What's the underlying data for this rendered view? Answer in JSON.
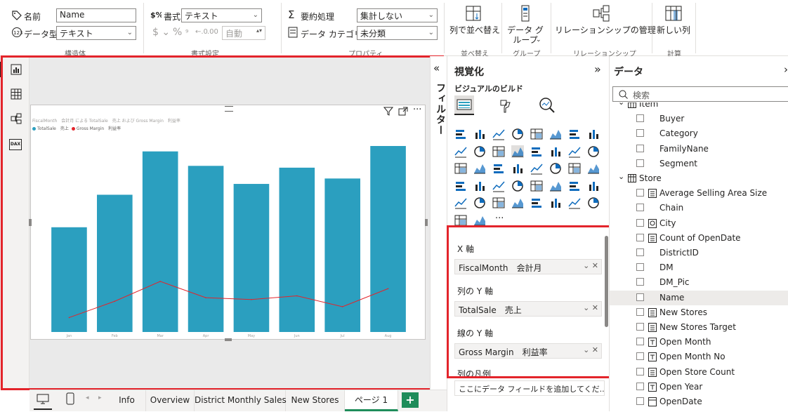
{
  "ribbon": {
    "structure": {
      "name_label": "名前",
      "name_value": "Name",
      "datatype_label": "データ型",
      "datatype_value": "テキスト",
      "group": "構造体"
    },
    "format": {
      "format_label": "書式",
      "format_value": "テキスト",
      "auto_value": "自動",
      "group": "書式設定"
    },
    "properties": {
      "summarize_label": "要約処理",
      "summarize_value": "集計しない",
      "category_label": "データ カテゴリ",
      "category_value": "未分類",
      "group": "プロパティ"
    },
    "sort": {
      "label": "列で並べ替え",
      "group": "並べ替え"
    },
    "groups": {
      "label": "データ グループ",
      "group": "グループ"
    },
    "relationships": {
      "label": "リレーションシップの管理",
      "group": "リレーションシップ"
    },
    "calc": {
      "label": "新しい列",
      "group": "計算"
    }
  },
  "rail": {
    "icons": [
      "report-view-icon",
      "table-view-icon",
      "model-view-icon",
      "dax-query-icon"
    ],
    "dax": "DAX"
  },
  "visual_header": {
    "title": "FiscalMonth　会計月 による TotalSale　売上 および Gross Margin　利益率",
    "legend_items": [
      {
        "label": "TotalSale　売上",
        "color": "#2b9fbf"
      },
      {
        "label": "Gross Margin　利益率",
        "color": "#e3242b"
      }
    ]
  },
  "chart_data": {
    "type": "bar",
    "categories": [
      "Jan",
      "Feb",
      "Mar",
      "Apr",
      "May",
      "Jun",
      "Jul",
      "Aug"
    ],
    "series": [
      {
        "name": "TotalSale　売上",
        "type": "bar",
        "values": [
          58,
          76,
          100,
          92,
          82,
          91,
          85,
          103
        ]
      },
      {
        "name": "Gross Margin　利益率",
        "type": "line",
        "values": [
          8,
          17,
          28,
          19,
          18,
          20,
          14,
          24
        ]
      }
    ],
    "ylim": [
      0,
      110
    ],
    "bar_color": "#2b9fbf",
    "line_color": "#e3242b"
  },
  "filter_pane": {
    "label": "フィルター"
  },
  "viz_pane": {
    "title": "視覚化",
    "build_label": "ビジュアルのビルド",
    "collapse_glyph": "»",
    "expand_glyph": "«",
    "wells": [
      {
        "title": "X 軸",
        "field": "FiscalMonth　会計月"
      },
      {
        "title": "列の Y 軸",
        "field": "TotalSale　売上"
      },
      {
        "title": "線の Y 軸",
        "field": "Gross Margin　利益率"
      },
      {
        "title": "列の凡例",
        "field": ""
      }
    ],
    "add_field_placeholder": "ここにデータ フィールドを追加してくだ...",
    "more_glyph": "···"
  },
  "data_pane": {
    "title": "データ",
    "search_placeholder": "検索",
    "top_table": "Item",
    "item_fields": [
      "Buyer",
      "Category",
      "FamilyNane",
      "Segment"
    ],
    "store_table": "Store",
    "store_fields": [
      {
        "label": "Average Selling Area Size",
        "icon": "measure-icon"
      },
      {
        "label": "Chain",
        "icon": ""
      },
      {
        "label": "City",
        "icon": "geo-icon"
      },
      {
        "label": "Count of OpenDate",
        "icon": "measure-icon"
      },
      {
        "label": "DistrictID",
        "icon": ""
      },
      {
        "label": "DM",
        "icon": ""
      },
      {
        "label": "DM_Pic",
        "icon": ""
      },
      {
        "label": "Name",
        "icon": "",
        "selected": true
      },
      {
        "label": "New Stores",
        "icon": "measure-icon"
      },
      {
        "label": "New Stores Target",
        "icon": "measure-icon"
      },
      {
        "label": "Open Month",
        "icon": "calc-column-icon"
      },
      {
        "label": "Open Month No",
        "icon": "calc-column-icon"
      },
      {
        "label": "Open Store Count",
        "icon": "measure-icon"
      },
      {
        "label": "Open Year",
        "icon": "calc-column-icon"
      },
      {
        "label": "OpenDate",
        "icon": "calendar-icon"
      }
    ]
  },
  "tabs": {
    "items": [
      "Info",
      "Overview",
      "District Monthly Sales",
      "New Stores",
      "ページ 1"
    ],
    "active": "ページ 1",
    "add_glyph": "+"
  }
}
